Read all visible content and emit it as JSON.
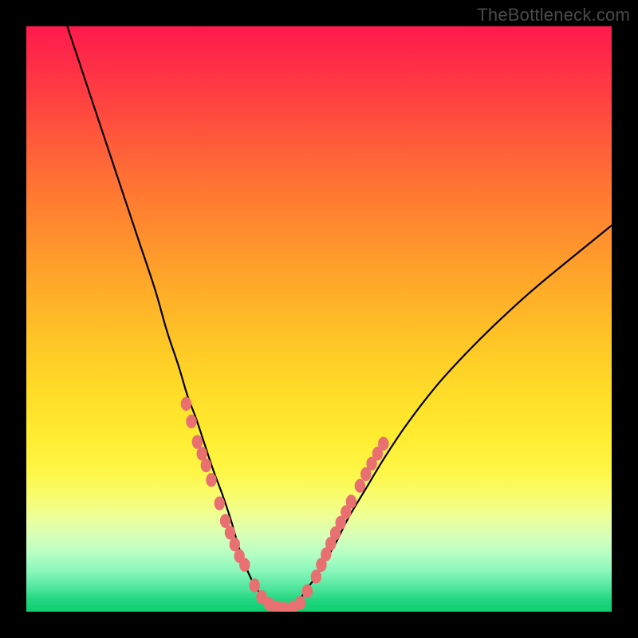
{
  "watermark": "TheBottleneck.com",
  "colors": {
    "background": "#000000",
    "curve": "#000000",
    "marker": "#e87070",
    "gradient_top": "#ff1a4d",
    "gradient_mid": "#ffec30",
    "gradient_bottom": "#0ecf70"
  },
  "chart_data": {
    "type": "line",
    "title": "",
    "xlabel": "",
    "ylabel": "",
    "xlim": [
      0,
      100
    ],
    "ylim": [
      0,
      100
    ],
    "series": [
      {
        "name": "left_curve",
        "x": [
          7,
          10,
          13,
          16,
          19,
          22,
          24,
          26,
          27.5,
          29,
          30.5,
          32,
          33.5,
          35,
          36,
          37,
          38,
          39,
          40,
          41,
          42,
          43
        ],
        "y": [
          100,
          91,
          82,
          73,
          64,
          55,
          48,
          42,
          37,
          33,
          28.5,
          24,
          20,
          15.5,
          12,
          9,
          6.5,
          4.5,
          3,
          1.8,
          1,
          0.5
        ]
      },
      {
        "name": "right_curve",
        "x": [
          45,
          46,
          47,
          48,
          49.5,
          51,
          53,
          55,
          58,
          61,
          65,
          70,
          75,
          80,
          86,
          92,
          100
        ],
        "y": [
          0.5,
          1.2,
          2.5,
          4,
          6,
          8.5,
          12,
          16,
          21,
          26,
          32,
          38.5,
          44,
          49,
          54.5,
          59.5,
          66
        ]
      }
    ],
    "markers": {
      "name": "data_points",
      "points": [
        [
          27.3,
          35.5
        ],
        [
          28.2,
          32.5
        ],
        [
          29.2,
          29.0
        ],
        [
          30.0,
          27.0
        ],
        [
          30.7,
          25.0
        ],
        [
          31.6,
          22.5
        ],
        [
          33.0,
          18.5
        ],
        [
          34.0,
          15.5
        ],
        [
          34.8,
          13.5
        ],
        [
          35.6,
          11.5
        ],
        [
          36.4,
          9.5
        ],
        [
          37.3,
          8.0
        ],
        [
          39.0,
          4.5
        ],
        [
          40.2,
          2.5
        ],
        [
          41.5,
          1.3
        ],
        [
          42.8,
          0.7
        ],
        [
          44.0,
          0.5
        ],
        [
          45.5,
          0.7
        ],
        [
          46.8,
          1.5
        ],
        [
          48.0,
          3.5
        ],
        [
          49.5,
          6.0
        ],
        [
          50.4,
          8.0
        ],
        [
          51.2,
          9.8
        ],
        [
          52.0,
          11.6
        ],
        [
          52.8,
          13.4
        ],
        [
          53.7,
          15.2
        ],
        [
          54.6,
          17.0
        ],
        [
          55.5,
          18.8
        ],
        [
          57.0,
          21.5
        ],
        [
          58.0,
          23.5
        ],
        [
          59.0,
          25.3
        ],
        [
          60.0,
          27.0
        ],
        [
          61.0,
          28.7
        ]
      ]
    }
  }
}
